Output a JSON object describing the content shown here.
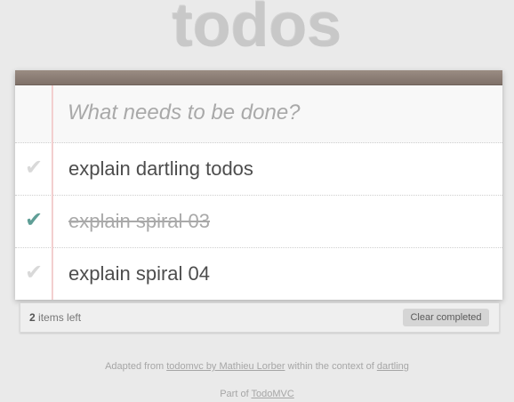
{
  "app": {
    "title": "todos"
  },
  "new_todo": {
    "placeholder": "What needs to be done?"
  },
  "todos": [
    {
      "label": "explain dartling todos",
      "completed": false
    },
    {
      "label": "explain spiral 03",
      "completed": true
    },
    {
      "label": "explain spiral 04",
      "completed": false
    }
  ],
  "icons": {
    "checkmark": "✔"
  },
  "footer": {
    "count": "2",
    "count_suffix": " items left",
    "clear_completed_label": "Clear completed"
  },
  "info": {
    "adapted_prefix": "Adapted from ",
    "adapted_link": "todomvc by Mathieu Lorber",
    "adapted_middle": " within the context of ",
    "dartling_link": "dartling",
    "part_of_prefix": "Part of ",
    "todomvc_link": "TodoMVC"
  },
  "colors": {
    "checked_accent": "#5f9e96",
    "top_band": "#8c7e75",
    "title_gray": "#c8c8c8"
  }
}
